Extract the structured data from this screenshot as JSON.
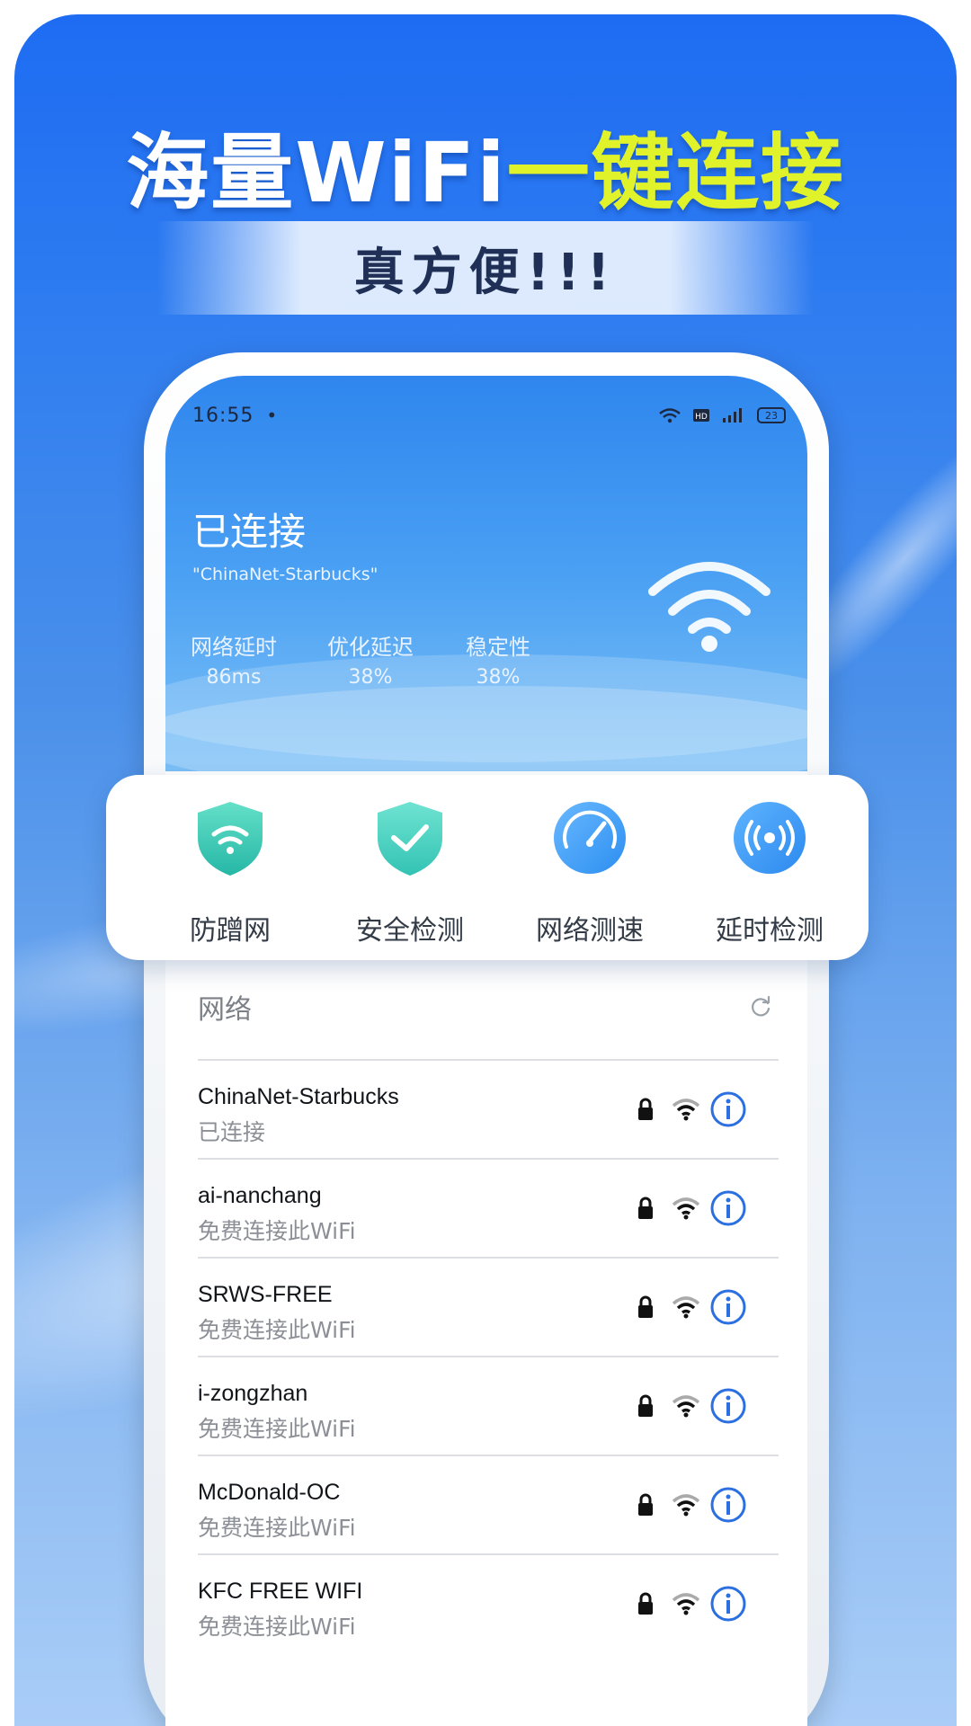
{
  "headline": {
    "white_part": "海量WiFi",
    "yellow_part": "一键连接"
  },
  "subtitle": "真方便!!!",
  "status_bar": {
    "time": "16:55",
    "dot": "•",
    "battery": "23"
  },
  "connection": {
    "status": "已连接",
    "ssid": "\"ChinaNet-Starbucks\"",
    "stats": [
      {
        "label": "网络延时",
        "value": "86ms"
      },
      {
        "label": "优化延迟",
        "value": "38%"
      },
      {
        "label": "稳定性",
        "value": "38%"
      }
    ]
  },
  "features": [
    {
      "label": "防蹭网",
      "icon": "wifi-shield-icon"
    },
    {
      "label": "安全检测",
      "icon": "check-shield-icon"
    },
    {
      "label": "网络测速",
      "icon": "speedometer-icon"
    },
    {
      "label": "延时检测",
      "icon": "signal-broadcast-icon"
    }
  ],
  "networks_section": {
    "title": "网络",
    "refresh_icon": "refresh-icon"
  },
  "networks": [
    {
      "name": "ChinaNet-Starbucks",
      "status": "已连接"
    },
    {
      "name": "ai-nanchang",
      "status": "免费连接此WiFi"
    },
    {
      "name": "SRWS-FREE",
      "status": "免费连接此WiFi"
    },
    {
      "name": "i-zongzhan",
      "status": "免费连接此WiFi"
    },
    {
      "name": "McDonald-OC",
      "status": "免费连接此WiFi"
    },
    {
      "name": "KFC FREE WIFI",
      "status": "免费连接此WiFi"
    }
  ],
  "colors": {
    "accent_yellow": "#dff22a",
    "accent_blue": "#2f86ee",
    "info_blue": "#2b6fe0"
  }
}
